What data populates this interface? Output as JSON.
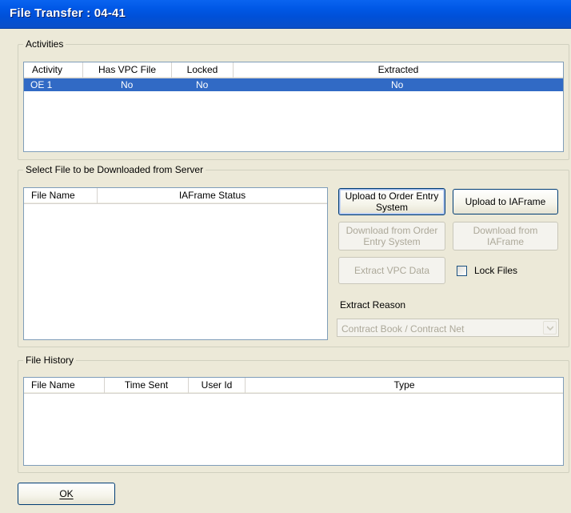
{
  "window": {
    "title": "File Transfer : 04-41"
  },
  "activities": {
    "legend": "Activities",
    "columns": [
      "Activity",
      "Has VPC File",
      "Locked",
      "Extracted"
    ],
    "rows": [
      {
        "activity": "OE 1",
        "has_vpc_file": "No",
        "locked": "No",
        "extracted": "No",
        "selected": true
      }
    ]
  },
  "download": {
    "legend": "Select File to be Downloaded from Server",
    "columns": [
      "File Name",
      "IAFrame Status"
    ],
    "buttons": {
      "upload_oe": "Upload to Order Entry System",
      "upload_iaframe": "Upload to IAFrame",
      "download_oe": "Download from Order Entry System",
      "download_iaframe": "Download from IAFrame",
      "extract_vpc": "Extract VPC Data"
    },
    "lock_files": {
      "label": "Lock Files",
      "checked": false
    },
    "extract_reason": {
      "label": "Extract Reason",
      "value": "Contract Book / Contract Net"
    }
  },
  "history": {
    "legend": "File History",
    "columns": [
      "File Name",
      "Time Sent",
      "User Id",
      "Type"
    ]
  },
  "ok_button": "OK",
  "colors": {
    "title_bar": "#0054E3",
    "selection": "#316AC5",
    "dialog_bg": "#ECE9D8",
    "disabled_text": "#ACA899"
  }
}
